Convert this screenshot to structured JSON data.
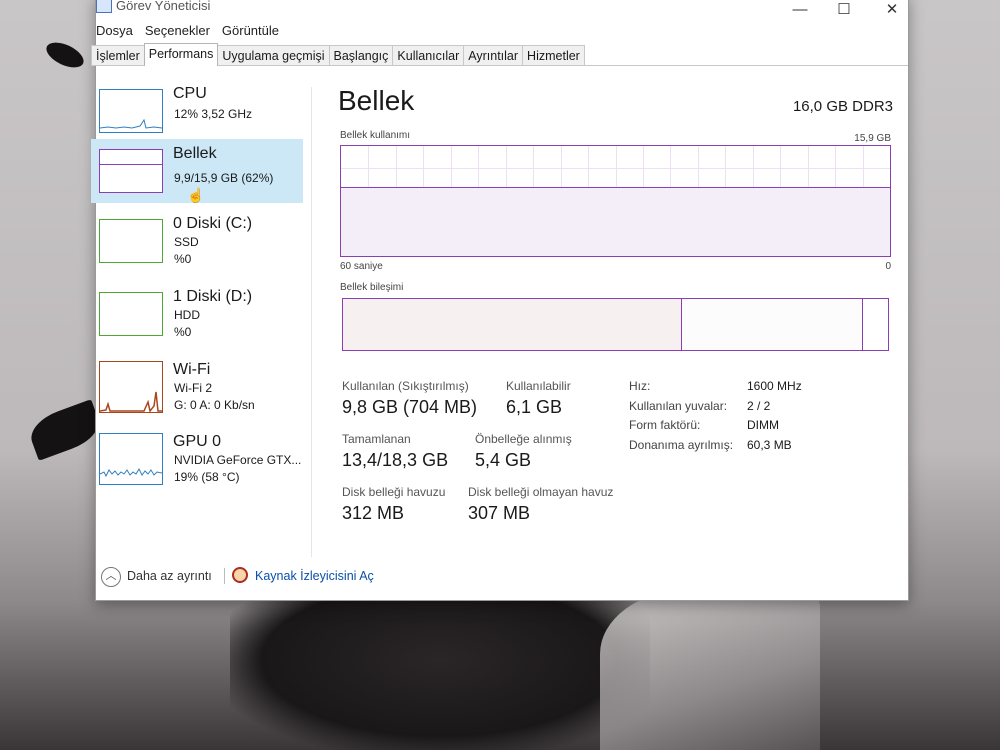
{
  "window": {
    "title": "Görev Yöneticisi"
  },
  "menu": [
    "Dosya",
    "Seçenekler",
    "Görüntüle"
  ],
  "tabs": [
    "İşlemler",
    "Performans",
    "Uygulama geçmişi",
    "Başlangıç",
    "Kullanıcılar",
    "Ayrıntılar",
    "Hizmetler"
  ],
  "active_tab": "Performans",
  "sidebar": {
    "items": [
      {
        "title": "CPU",
        "sub1": "12% 3,52 GHz",
        "sub2": "",
        "color": "#2f7fc1"
      },
      {
        "title": "Bellek",
        "sub1": "9,9/15,9 GB (62%)",
        "sub2": "",
        "color": "#8b3eb3"
      },
      {
        "title": "0 Diski (C:)",
        "sub1": "SSD",
        "sub2": "%0",
        "color": "#4da833"
      },
      {
        "title": "1 Diski (D:)",
        "sub1": "HDD",
        "sub2": "%0",
        "color": "#4da833"
      },
      {
        "title": "Wi-Fi",
        "sub1": "Wi-Fi 2",
        "sub2": "G: 0 A: 0 Kb/sn",
        "color": "#a8471f"
      },
      {
        "title": "GPU 0",
        "sub1": "NVIDIA GeForce GTX...",
        "sub2": "19% (58 °C)",
        "color": "#2f7fc1"
      }
    ]
  },
  "main": {
    "title": "Bellek",
    "spec": "16,0 GB DDR3",
    "usage_label": "Bellek kullanımı",
    "usage_max": "15,9 GB",
    "axis_left": "60 saniye",
    "axis_right": "0",
    "usage_fraction": 0.62,
    "composition_label": "Bellek bileşimi",
    "composition": {
      "in_use": 0.62,
      "modified": 0.0,
      "standby": 0.33,
      "free": 0.04
    },
    "stats": {
      "used_label": "Kullanılan (Sıkıştırılmış)",
      "used_value": "9,8 GB (704 MB)",
      "available_label": "Kullanılabilir",
      "available_value": "6,1 GB",
      "committed_label": "Tamamlanan",
      "committed_value": "13,4/18,3 GB",
      "cached_label": "Önbelleğe alınmış",
      "cached_value": "5,4 GB",
      "paged_label": "Disk belleği havuzu",
      "paged_value": "312 MB",
      "nonpaged_label": "Disk belleği olmayan havuz",
      "nonpaged_value": "307 MB"
    },
    "specs": {
      "speed_label": "Hız:",
      "speed_value": "1600 MHz",
      "slots_label": "Kullanılan yuvalar:",
      "slots_value": "2 / 2",
      "form_label": "Form faktörü:",
      "form_value": "DIMM",
      "reserved_label": "Donanıma ayrılmış:",
      "reserved_value": "60,3 MB"
    }
  },
  "footer": {
    "fewer_details": "Daha az ayrıntı",
    "resource_monitor": "Kaynak İzleyicisini Aç"
  }
}
